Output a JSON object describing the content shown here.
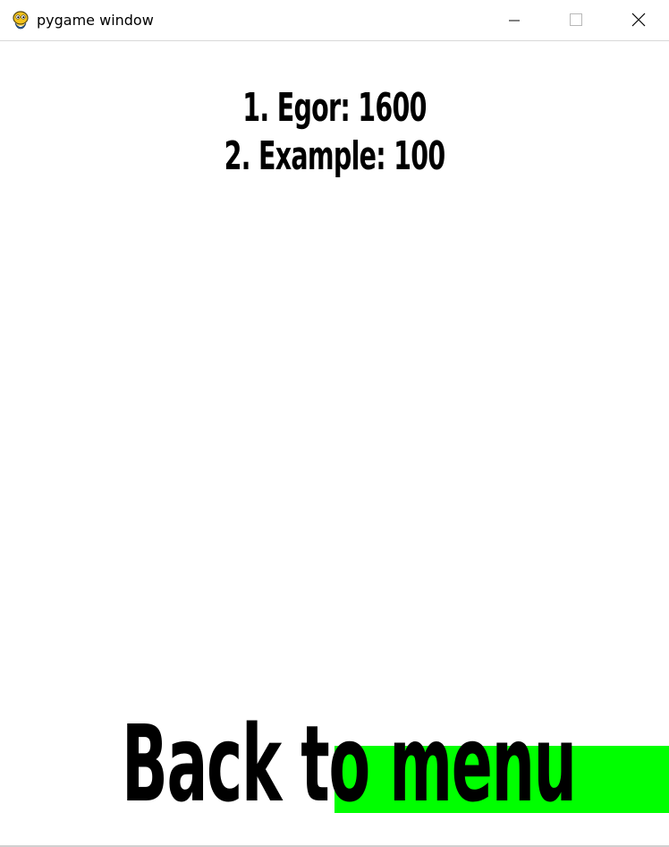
{
  "window": {
    "title": "pygame window",
    "icon": "pygame-snake-icon",
    "controls": {
      "minimize_icon": "minimize-icon",
      "maximize_icon": "maximize-icon",
      "close_icon": "close-icon"
    }
  },
  "leaderboard": {
    "entries": [
      {
        "text": "1. Egor: 1600"
      },
      {
        "text": "2. Example: 100"
      }
    ]
  },
  "menu": {
    "back_label": "Back to menu",
    "highlight_color": "#00ff00"
  },
  "colors": {
    "background": "#ffffff",
    "text": "#000000"
  }
}
